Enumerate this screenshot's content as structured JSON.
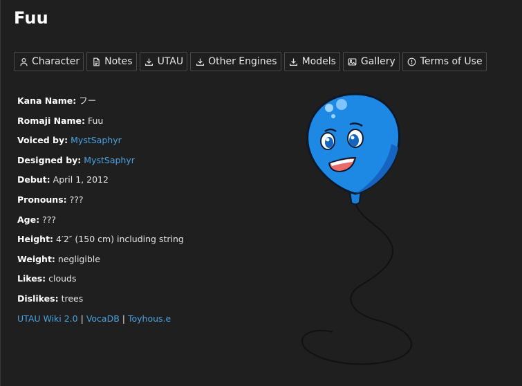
{
  "page": {
    "title": "Fuu"
  },
  "tabs": [
    {
      "label": "Character",
      "icon": "person-icon"
    },
    {
      "label": "Notes",
      "icon": "document-icon"
    },
    {
      "label": "UTAU",
      "icon": "download-icon"
    },
    {
      "label": "Other Engines",
      "icon": "download-icon"
    },
    {
      "label": "Models",
      "icon": "download-icon"
    },
    {
      "label": "Gallery",
      "icon": "image-icon"
    },
    {
      "label": "Terms of Use",
      "icon": "info-circle-icon"
    }
  ],
  "info": {
    "kana_label": "Kana Name:",
    "kana_value": "フー",
    "romaji_label": "Romaji Name:",
    "romaji_value": "Fuu",
    "voiced_label": "Voiced by:",
    "voiced_value": "MystSaphyr",
    "designed_label": "Designed by:",
    "designed_value": "MystSaphyr",
    "debut_label": "Debut:",
    "debut_value": "April 1, 2012",
    "pronouns_label": "Pronouns:",
    "pronouns_value": "???",
    "age_label": "Age:",
    "age_value": "???",
    "height_label": "Height:",
    "height_value": "4′2″ (150 cm) including string",
    "weight_label": "Weight:",
    "weight_value": "negligible",
    "likes_label": "Likes:",
    "likes_value": "clouds",
    "dislikes_label": "Dislikes:",
    "dislikes_value": "trees"
  },
  "links": {
    "wiki": "UTAU Wiki 2.0",
    "vocadb": "VocaDB",
    "toyhouse": "Toyhous.e",
    "separator": "|"
  },
  "colors": {
    "background": "#1f1f1f",
    "link": "#4aa3e0",
    "balloon": "#1e88e5"
  }
}
